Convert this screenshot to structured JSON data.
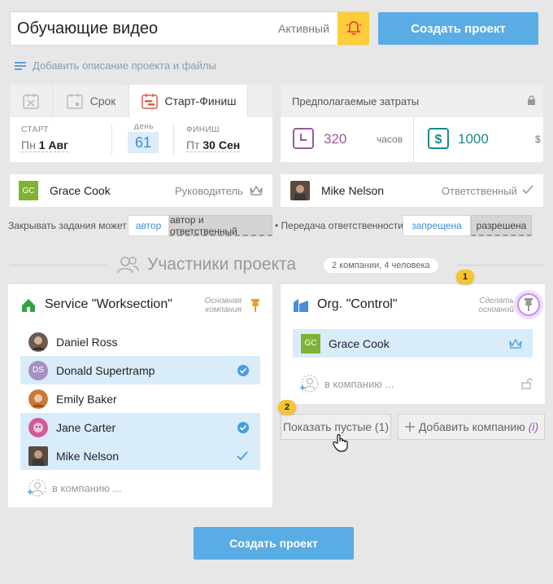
{
  "project": {
    "title": "Обучающие видео",
    "status": "Активный",
    "create_label": "Создать проект",
    "add_description": "Добавить описание проекта и файлы"
  },
  "dates": {
    "tabs": [
      {
        "label": ""
      },
      {
        "label": "Срок"
      },
      {
        "label": "Старт-Финиш"
      }
    ],
    "start_label": "СТАРТ",
    "start_dow": "Пн",
    "start_date": "1 Авг",
    "days_label": "день",
    "days": "61",
    "finish_label": "ФИНИШ",
    "finish_dow": "Пт",
    "finish_date": "30 Сен"
  },
  "costs": {
    "label": "Предполагаемые затраты",
    "hours": "320",
    "hours_unit": "часов",
    "money": "1000",
    "money_unit": "$"
  },
  "leader": {
    "initials": "GC",
    "name": "Grace Cook",
    "role": "Руководитель"
  },
  "responsible": {
    "name": "Mike Nelson",
    "role": "Ответственный"
  },
  "options": {
    "close_label": "Закрывать задания может",
    "close_opt1": "автор",
    "close_opt2": "автор и ответственный",
    "transfer_label": "• Передача ответственности",
    "transfer_opt1": "запрещена",
    "transfer_opt2": "разрешена"
  },
  "participants": {
    "title": "Участники проекта",
    "summary": "2 компании, 4 человека"
  },
  "company1": {
    "name": "Service \"Worksection\"",
    "role_line1": "Основная",
    "role_line2": "компания",
    "members": [
      {
        "name": "Daniel Ross",
        "selected": false
      },
      {
        "name": "Donald Supertramp",
        "initials": "DS",
        "selected": true
      },
      {
        "name": "Emily Baker",
        "selected": false
      },
      {
        "name": "Jane Carter",
        "selected": true
      },
      {
        "name": "Mike Nelson",
        "selected": true
      }
    ],
    "add_member": "в компанию ..."
  },
  "company2": {
    "name": "Org. \"Control\"",
    "role_line1": "Сделать",
    "role_line2": "основной",
    "members": [
      {
        "name": "Grace Cook",
        "initials": "GC"
      }
    ],
    "add_member": "в компанию ..."
  },
  "actions": {
    "show_empty": "Показать пустые (1)",
    "add_company": "Добавить компанию",
    "add_company_info": "(i)"
  },
  "hints": {
    "badge1": "1",
    "badge2": "2"
  },
  "colors": {
    "accent": "#5aace5",
    "bell": "#ffcc3a",
    "selected_row": "#d9ecfa",
    "hours": "#9a5a9a",
    "money": "#1a8a8a"
  }
}
